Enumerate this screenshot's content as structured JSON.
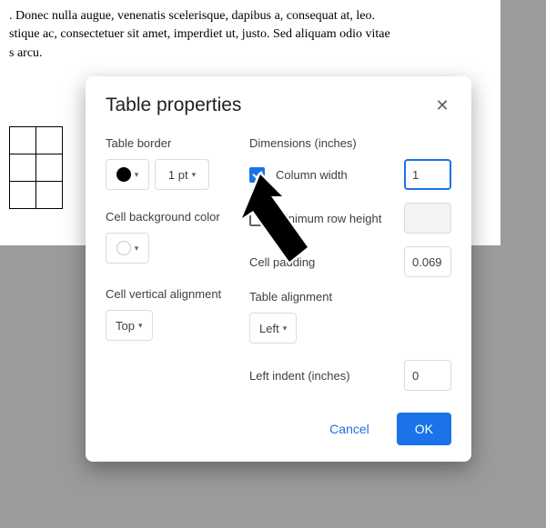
{
  "doc": {
    "line1": ". Donec nulla augue, venenatis scelerisque, dapibus a, consequat at, leo.",
    "line2": "stique ac, consectetuer sit amet, imperdiet ut, justo. Sed aliquam odio vitae",
    "line3": "s arcu."
  },
  "dialog": {
    "title": "Table properties",
    "left": {
      "border_label": "Table border",
      "pt_value": "1 pt",
      "bg_label": "Cell background color",
      "valign_label": "Cell vertical alignment",
      "valign_value": "Top"
    },
    "right": {
      "dim_label": "Dimensions  (inches)",
      "col_width_label": "Column width",
      "col_width_value": "1",
      "row_height_label": "Minimum row height",
      "row_height_value": "",
      "cell_padding_label": "Cell padding",
      "cell_padding_value": "0.069",
      "table_align_label": "Table alignment",
      "table_align_value": "Left",
      "left_indent_label": "Left indent  (inches)",
      "left_indent_value": "0"
    },
    "footer": {
      "cancel": "Cancel",
      "ok": "OK"
    }
  }
}
